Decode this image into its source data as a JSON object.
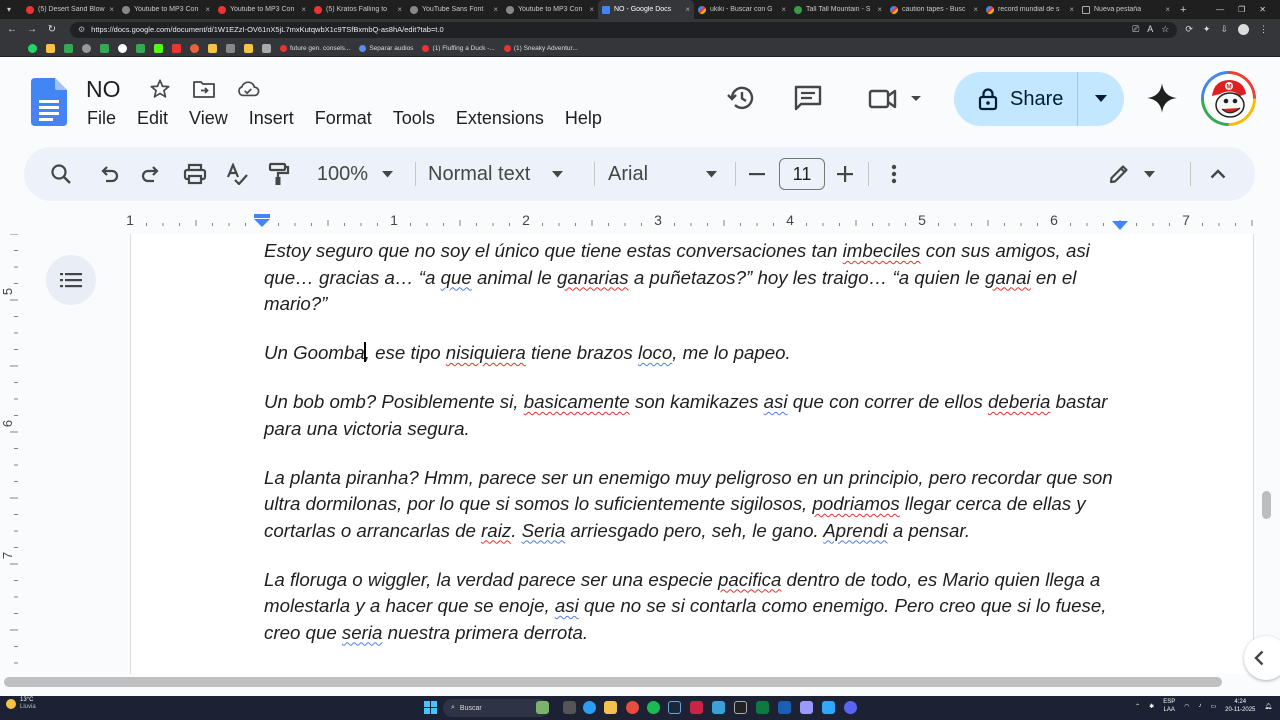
{
  "browser": {
    "tabs": [
      {
        "title": "(5) Desert Sand Blow",
        "icon": "yt"
      },
      {
        "title": "Youtube to MP3 Con",
        "icon": "gray"
      },
      {
        "title": "Youtube to MP3 Con",
        "icon": "yt"
      },
      {
        "title": "(5) Kratos Falling to",
        "icon": "yt"
      },
      {
        "title": "YouTube Sans Font",
        "icon": "gray"
      },
      {
        "title": "Youtube to MP3 Con",
        "icon": "gray"
      },
      {
        "title": "NO - Google Docs",
        "icon": "doc",
        "active": true
      },
      {
        "title": "ukiki - Buscar con G",
        "icon": "g"
      },
      {
        "title": "Tall Tall Mountain - S",
        "icon": "gray"
      },
      {
        "title": "caution tapes - Busc",
        "icon": "g"
      },
      {
        "title": "record mundial de s",
        "icon": "g"
      },
      {
        "title": "Nueva pestaña",
        "icon": "none"
      }
    ],
    "url": "https://docs.google.com/document/d/1W1EZzI-OV61nX5jL7mxKutqwbX1c9TSfBxmbQ-as8hA/edit?tab=t.0",
    "bookmarks": [
      {
        "label": "future gen. consels...",
        "color": "yt"
      },
      {
        "label": "Separar audios",
        "color": "blue"
      },
      {
        "label": "(1) Fluffing a Duck -...",
        "color": "yt"
      },
      {
        "label": "(1) Sneaky Adventur...",
        "color": "yt"
      }
    ]
  },
  "docs": {
    "title": "NO",
    "menu": [
      "File",
      "Edit",
      "View",
      "Insert",
      "Format",
      "Tools",
      "Extensions",
      "Help"
    ],
    "share_label": "Share",
    "toolbar": {
      "zoom": "100%",
      "style": "Normal text",
      "font": "Arial",
      "font_size": "11"
    },
    "ruler_numbers": [
      "1",
      "1",
      "2",
      "3",
      "4",
      "5",
      "6",
      "7"
    ],
    "vruler_numbers": [
      "5",
      "6",
      "7"
    ],
    "paragraphs": {
      "p1": {
        "a": "Estoy seguro que no soy el único que tiene estas conversaciones tan ",
        "b": "imbeciles",
        "c": " con sus amigos, asi que… gracias a… “a ",
        "d": "que",
        "e": " animal le ",
        "f": "ganarias",
        "g": " a puñetazos?” hoy les traigo… “a quien le ",
        "h": "ganai",
        "i": " en el mario?”"
      },
      "p2": {
        "a": "Un Goomba",
        "b": ", ese tipo ",
        "c": "nisiquiera",
        "d": " tiene brazos ",
        "e": "loco",
        "f": ", me lo papeo."
      },
      "p3": {
        "a": "Un bob omb? Posiblemente si, ",
        "b": "basicamente",
        "c": " son kamikazes ",
        "d": "asi",
        "e": " que con correr de ellos ",
        "f": "deberia",
        "g": " bastar para una victoria segura."
      },
      "p4": {
        "a": "La planta piranha? Hmm, parece ser un enemigo muy peligroso en un principio, pero recordar que son ultra dormilonas, por lo que si somos lo suficientemente sigilosos, ",
        "b": "podriamos",
        "c": " llegar cerca de ellas y cortarlas o arrancarlas de ",
        "d": "raiz",
        "e": ". ",
        "f": "Seria",
        "g": " arriesgado pero, seh, le gano. ",
        "h": "Aprendi",
        "i": " a pensar."
      },
      "p5": {
        "a": "La floruga o wiggler, la verdad parece ser una especie ",
        "b": "pacifica",
        "c": " dentro de todo, es Mario quien llega a molestarla y a hacer que se enoje, ",
        "d": "asi",
        "e": " que no se si contarla como enemigo. Pero creo que si lo fuese, creo que ",
        "f": "seria",
        "g": " nuestra primera derrota."
      }
    }
  },
  "taskbar": {
    "temp": "13°C",
    "weather": "Lluvia",
    "search_placeholder": "Buscar",
    "lang": "ESP",
    "lang2": "LAA",
    "time": "4:24",
    "date": "20-11-2025"
  },
  "colors": {
    "share_bg": "#c2e7ff",
    "toolbar_bg": "#edf2fa",
    "spell_red": "#e0342d",
    "grammar_blue": "#4f7de8",
    "docs_blue": "#4285f4"
  }
}
